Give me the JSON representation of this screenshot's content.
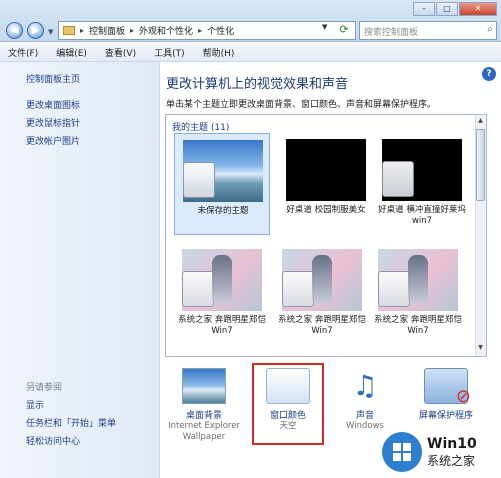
{
  "address": {
    "crumbs": [
      "控制面板",
      "外观和个性化",
      "个性化"
    ],
    "search_placeholder": "搜索控制面板"
  },
  "menu": [
    "文件(F)",
    "编辑(E)",
    "查看(V)",
    "工具(T)",
    "帮助(H)"
  ],
  "sidebar": {
    "home": "控制面板主页",
    "links": [
      "更改桌面图标",
      "更改鼠标指针",
      "更改帐户图片"
    ],
    "see_also": "另请参阅",
    "bottom_links": [
      "显示",
      "任务栏和「开始」菜单",
      "轻松访问中心"
    ]
  },
  "main": {
    "title": "更改计算机上的视觉效果和声音",
    "desc": "单击某个主题立即更改桌面背景、窗口颜色、声音和屏幕保护程序。",
    "group_label": "我的主题 (11)",
    "themes": [
      {
        "name": "未保存的主题",
        "thumb": "sky",
        "selected": true
      },
      {
        "name": "好桌道 校园制服美女",
        "thumb": "black"
      },
      {
        "name": "好桌道 横冲直撞好莱坞win7",
        "thumb": "black"
      },
      {
        "name": "系统之家 奔跑明星郑恺Win7",
        "thumb": "person"
      },
      {
        "name": "系统之家 奔跑明星郑恺Win7",
        "thumb": "person"
      },
      {
        "name": "系统之家 奔跑明星郑恺Win7",
        "thumb": "person"
      }
    ]
  },
  "settings": [
    {
      "title": "桌面背景",
      "sub": "Internet Explorer Wallpaper",
      "icon": "wallpaper-icon"
    },
    {
      "title": "窗口颜色",
      "sub": "天空",
      "icon": "window-color-icon"
    },
    {
      "title": "声音",
      "sub": "Windows",
      "icon": "sound-icon"
    },
    {
      "title": "屏幕保护程序",
      "sub": "",
      "icon": "screensaver-icon"
    }
  ],
  "watermark": {
    "line1": "Win10",
    "line2": "系统之家"
  }
}
